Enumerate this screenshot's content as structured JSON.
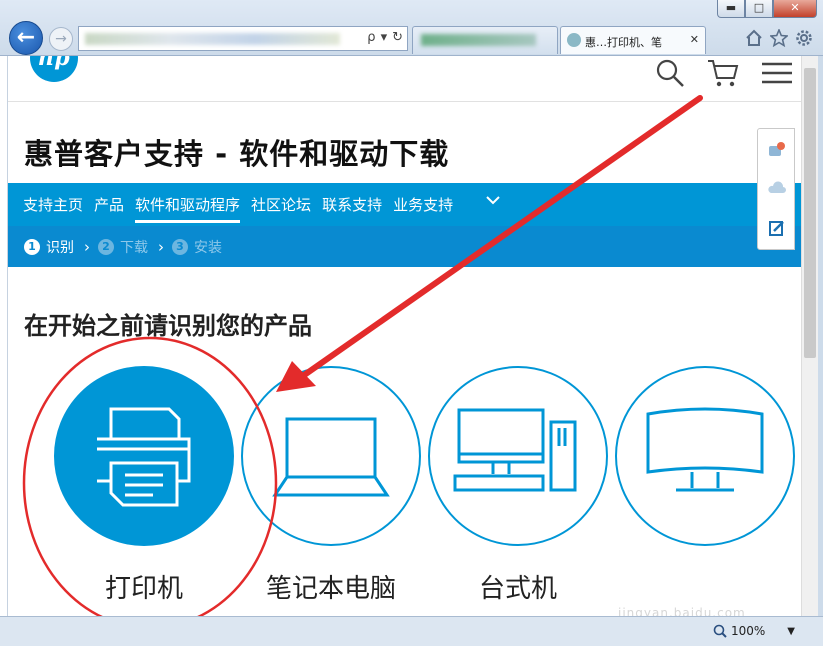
{
  "window": {
    "min_label": "▬",
    "max_label": "□",
    "close_label": "✕"
  },
  "browser": {
    "back_label": "←",
    "forward_label": "→",
    "address_icons": [
      "ρ",
      "▾",
      "↻"
    ],
    "tabs": [
      {
        "label": ""
      },
      {
        "label": "惠…打印机、笔",
        "close": "✕"
      }
    ],
    "tool_icons": [
      "home-icon",
      "star-icon",
      "gear-icon"
    ]
  },
  "header": {
    "logo_text": "hp"
  },
  "page": {
    "title": "惠普客户支持 - 软件和驱动下载",
    "nav": {
      "items": [
        {
          "label": "支持主页",
          "active": false
        },
        {
          "label": "产品",
          "active": false
        },
        {
          "label": "软件和驱动程序",
          "active": true
        },
        {
          "label": "社区论坛",
          "active": false
        },
        {
          "label": "联系支持",
          "active": false
        },
        {
          "label": "业务支持",
          "active": false
        }
      ],
      "more_icon": "chevron-down-icon"
    },
    "steps": [
      {
        "num": "1",
        "label": "识别",
        "active": true
      },
      {
        "num": "2",
        "label": "下载",
        "active": false
      },
      {
        "num": "3",
        "label": "安装",
        "active": false
      }
    ],
    "subtitle": "在开始之前请识别您的产品",
    "products": [
      {
        "label": "打印机",
        "icon": "printer-icon",
        "selected": true
      },
      {
        "label": "笔记本电脑",
        "icon": "laptop-icon",
        "selected": false
      },
      {
        "label": "台式机",
        "icon": "desktop-icon",
        "selected": false
      },
      {
        "label": "",
        "icon": "monitor-icon",
        "selected": false
      }
    ]
  },
  "statusbar": {
    "zoom": "100%"
  },
  "watermark": "jingyan.baidu.com",
  "colors": {
    "brand": "#0096d6",
    "annotation": "#e32b2b"
  }
}
